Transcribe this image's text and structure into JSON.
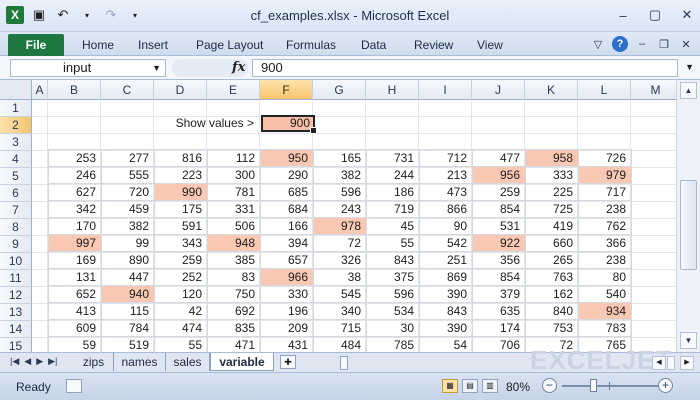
{
  "window": {
    "title": "cf_examples.xlsx  -  Microsoft Excel",
    "app_icon": "X"
  },
  "ribbon": {
    "file_label": "File",
    "tabs": [
      "Home",
      "Insert",
      "Page Layout",
      "Formulas",
      "Data",
      "Review",
      "View"
    ]
  },
  "formula_bar": {
    "name_box": "input",
    "fx_label": "fx",
    "formula": "900"
  },
  "grid": {
    "columns": [
      "A",
      "B",
      "C",
      "D",
      "E",
      "F",
      "G",
      "H",
      "I",
      "J",
      "K",
      "L",
      "M"
    ],
    "selected_column": "F",
    "rows": [
      1,
      2,
      3,
      4,
      5,
      6,
      7,
      8,
      9,
      10,
      11,
      12,
      13,
      14,
      15
    ],
    "selected_row": 2,
    "label_text": "Show values >",
    "input_value": "900",
    "highlight_color": "#f9c8b2",
    "table": [
      [
        253,
        277,
        816,
        112,
        950,
        165,
        731,
        712,
        477,
        958,
        726
      ],
      [
        246,
        555,
        223,
        300,
        290,
        382,
        244,
        213,
        956,
        333,
        979
      ],
      [
        627,
        720,
        990,
        781,
        685,
        596,
        186,
        473,
        259,
        225,
        717
      ],
      [
        342,
        459,
        175,
        331,
        684,
        243,
        719,
        866,
        854,
        725,
        238
      ],
      [
        170,
        382,
        591,
        506,
        166,
        978,
        45,
        90,
        531,
        419,
        762
      ],
      [
        997,
        99,
        343,
        948,
        394,
        72,
        55,
        542,
        922,
        660,
        366
      ],
      [
        169,
        890,
        259,
        385,
        657,
        326,
        843,
        251,
        356,
        265,
        238
      ],
      [
        131,
        447,
        252,
        83,
        966,
        38,
        375,
        869,
        854,
        763,
        80
      ],
      [
        652,
        940,
        120,
        750,
        330,
        545,
        596,
        390,
        379,
        162,
        540
      ],
      [
        413,
        115,
        42,
        692,
        196,
        340,
        534,
        843,
        635,
        840,
        934
      ],
      [
        609,
        784,
        474,
        835,
        209,
        715,
        30,
        390,
        174,
        753,
        783
      ],
      [
        59,
        519,
        55,
        471,
        431,
        484,
        785,
        54,
        706,
        72,
        765
      ]
    ]
  },
  "sheets": {
    "tabs": [
      "zips",
      "names",
      "sales",
      "variable"
    ],
    "active": "variable",
    "watermark": "EXCELJET"
  },
  "status": {
    "ready": "Ready",
    "zoom": "80%"
  }
}
